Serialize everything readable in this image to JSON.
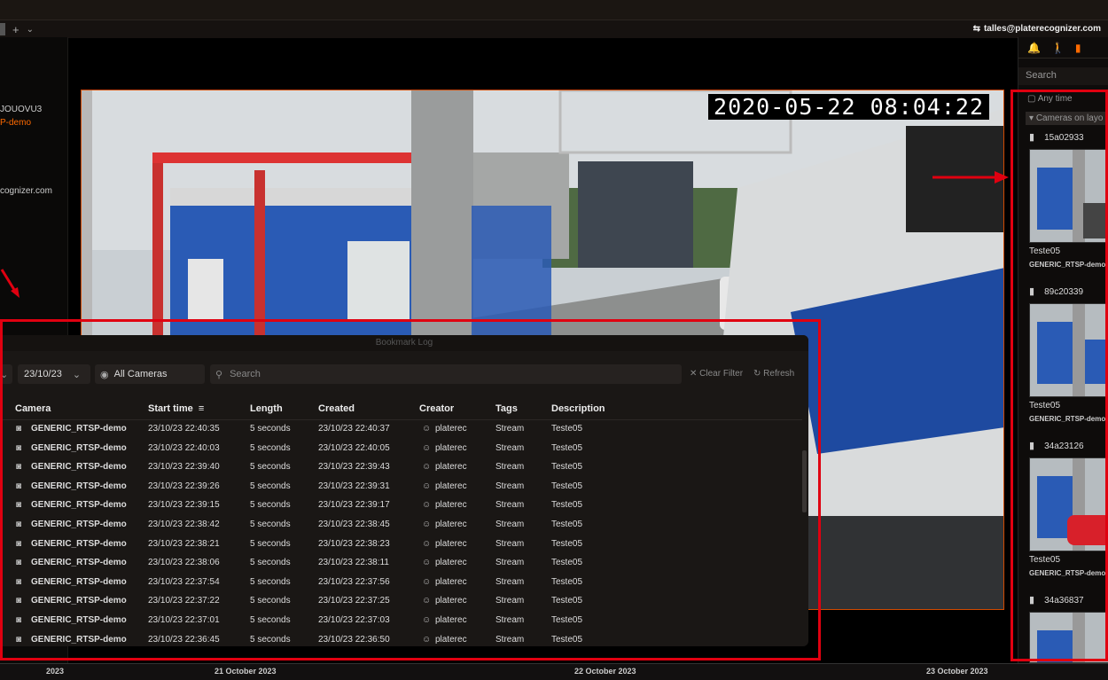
{
  "user": {
    "email": "talles@platerecognizer.com"
  },
  "left_panel": {
    "camera_id_fragment": "JOUOVU3",
    "camera_name_fragment": "P-demo",
    "email_fragment": "cognizer.com"
  },
  "video": {
    "timestamp": "2020-05-22  08:04:22"
  },
  "right_panel": {
    "search_placeholder": "Search",
    "filter_time": "Any time",
    "filter_cameras": "Cameras on layo",
    "bookmarks": [
      {
        "id": "15a02933",
        "description": "Teste05",
        "camera": "GENERIC_RTSP-demo"
      },
      {
        "id": "89c20339",
        "description": "Teste05",
        "camera": "GENERIC_RTSP-demo"
      },
      {
        "id": "34a23126",
        "description": "Teste05",
        "camera": "GENERIC_RTSP-demo"
      },
      {
        "id": "34a36837",
        "description": "",
        "camera": ""
      }
    ]
  },
  "bookmark_log": {
    "title": "Bookmark Log",
    "date_value": "23/10/23",
    "cameras_label": "All Cameras",
    "search_placeholder": "Search",
    "clear_filter": "Clear Filter",
    "refresh": "Refresh",
    "columns": {
      "camera": "Camera",
      "start_time": "Start time",
      "length": "Length",
      "created": "Created",
      "creator": "Creator",
      "tags": "Tags",
      "description": "Description"
    },
    "rows": [
      {
        "camera": "GENERIC_RTSP-demo",
        "start": "23/10/23 22:40:35",
        "length": "5 seconds",
        "created": "23/10/23 22:40:37",
        "creator": "platerec",
        "tags": "Stream",
        "description": "Teste05"
      },
      {
        "camera": "GENERIC_RTSP-demo",
        "start": "23/10/23 22:40:03",
        "length": "5 seconds",
        "created": "23/10/23 22:40:05",
        "creator": "platerec",
        "tags": "Stream",
        "description": "Teste05"
      },
      {
        "camera": "GENERIC_RTSP-demo",
        "start": "23/10/23 22:39:40",
        "length": "5 seconds",
        "created": "23/10/23 22:39:43",
        "creator": "platerec",
        "tags": "Stream",
        "description": "Teste05"
      },
      {
        "camera": "GENERIC_RTSP-demo",
        "start": "23/10/23 22:39:26",
        "length": "5 seconds",
        "created": "23/10/23 22:39:31",
        "creator": "platerec",
        "tags": "Stream",
        "description": "Teste05"
      },
      {
        "camera": "GENERIC_RTSP-demo",
        "start": "23/10/23 22:39:15",
        "length": "5 seconds",
        "created": "23/10/23 22:39:17",
        "creator": "platerec",
        "tags": "Stream",
        "description": "Teste05"
      },
      {
        "camera": "GENERIC_RTSP-demo",
        "start": "23/10/23 22:38:42",
        "length": "5 seconds",
        "created": "23/10/23 22:38:45",
        "creator": "platerec",
        "tags": "Stream",
        "description": "Teste05"
      },
      {
        "camera": "GENERIC_RTSP-demo",
        "start": "23/10/23 22:38:21",
        "length": "5 seconds",
        "created": "23/10/23 22:38:23",
        "creator": "platerec",
        "tags": "Stream",
        "description": "Teste05"
      },
      {
        "camera": "GENERIC_RTSP-demo",
        "start": "23/10/23 22:38:06",
        "length": "5 seconds",
        "created": "23/10/23 22:38:11",
        "creator": "platerec",
        "tags": "Stream",
        "description": "Teste05"
      },
      {
        "camera": "GENERIC_RTSP-demo",
        "start": "23/10/23 22:37:54",
        "length": "5 seconds",
        "created": "23/10/23 22:37:56",
        "creator": "platerec",
        "tags": "Stream",
        "description": "Teste05"
      },
      {
        "camera": "GENERIC_RTSP-demo",
        "start": "23/10/23 22:37:22",
        "length": "5 seconds",
        "created": "23/10/23 22:37:25",
        "creator": "platerec",
        "tags": "Stream",
        "description": "Teste05"
      },
      {
        "camera": "GENERIC_RTSP-demo",
        "start": "23/10/23 22:37:01",
        "length": "5 seconds",
        "created": "23/10/23 22:37:03",
        "creator": "platerec",
        "tags": "Stream",
        "description": "Teste05"
      },
      {
        "camera": "GENERIC_RTSP-demo",
        "start": "23/10/23 22:36:45",
        "length": "5 seconds",
        "created": "23/10/23 22:36:50",
        "creator": "platerec",
        "tags": "Stream",
        "description": "Teste05"
      }
    ]
  },
  "timeline": {
    "labels": [
      "2023",
      "21 October 2023",
      "22 October 2023",
      "23 October 2023"
    ]
  },
  "colors": {
    "accent": "#ff6a00",
    "highlight": "#e00010"
  }
}
